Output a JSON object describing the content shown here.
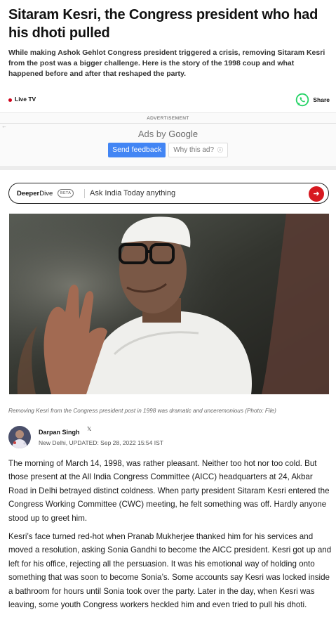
{
  "article": {
    "headline": "Sitaram Kesri, the Congress president who had his dhoti pulled",
    "summary": "While making Ashok Gehlot Congress president triggered a crisis, removing Sitaram Kesri from the post was a bigger challenge. Here is the story of the 1998 coup and what happened before and after that reshaped the party.",
    "live_label": "Live TV",
    "share_label": "Share",
    "caption": "Removing Kesri from the Congress president post in 1998 was dramatic and unceremonious (Photo: File)",
    "author": "Darpan Singh",
    "dateline": "New Delhi, UPDATED: Sep 28, 2022 15:54 IST",
    "paragraphs": [
      "The morning of March 14, 1998, was rather pleasant. Neither too hot nor too cold. But those present at the All India Congress Committee (AICC) headquarters at 24, Akbar Road in Delhi betrayed distinct coldness. When party president Sitaram Kesri entered the Congress Working Committee (CWC) meeting, he felt something was off. Hardly anyone stood up to greet him.",
      "Kesri’s face turned red-hot when Pranab Mukherjee thanked him for his services and moved a resolution, asking Sonia Gandhi to become the AICC president. Kesri got up and left for his office, rejecting all the persuasion. It was his emotional way of holding onto something that was soon to become Sonia’s. Some accounts say Kesri was locked inside a bathroom for hours until Sonia took over the party. Later in the day, when Kesri was leaving, some youth Congress workers heckled him and even tried to pull his dhoti."
    ]
  },
  "ad": {
    "tag": "ADVERTISEMENT",
    "ads_by_prefix": "Ads by ",
    "ads_by_brand": "Google",
    "feedback_label": "Send feedback",
    "why_label": "Why this ad?"
  },
  "deeperdive": {
    "brand_bold": "Deeper",
    "brand_rest": "Dive",
    "beta": "BETA",
    "placeholder": "Ask India Today anything"
  },
  "colors": {
    "live_dot": "#d0021b",
    "whatsapp": "#25d366",
    "google_blue": "#4285f4",
    "deeperdive_go": "#d71920"
  },
  "icons": [
    "whatsapp-icon",
    "back-arrow-icon",
    "info-icon",
    "arrow-right-icon",
    "x-social-icon"
  ]
}
